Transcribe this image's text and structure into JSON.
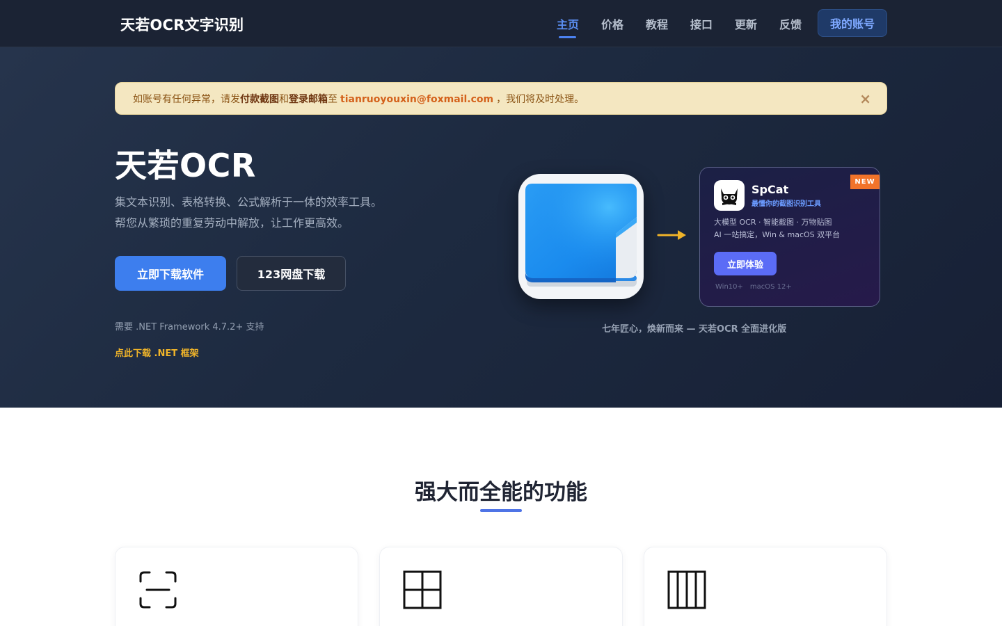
{
  "nav": {
    "brand": "天若OCR文字识别",
    "links": [
      {
        "label": "主页",
        "active": true
      },
      {
        "label": "价格",
        "active": false
      },
      {
        "label": "教程",
        "active": false
      },
      {
        "label": "接口",
        "active": false
      },
      {
        "label": "更新",
        "active": false
      },
      {
        "label": "反馈",
        "active": false
      }
    ],
    "account_label": "我的账号"
  },
  "notice": {
    "text_1": "如账号有任何异常，请发",
    "bold_1": "付款截图",
    "text_2": "和",
    "bold_2": "登录邮箱",
    "text_3": "至",
    "email": "tianruoyouxin@foxmail.com",
    "text_4": "，我们将及时处理。",
    "close_glyph": "×"
  },
  "hero": {
    "title": "天若OCR",
    "desc_line1": "集文本识别、表格转换、公式解析于一体的效率工具。",
    "desc_line2": "帮您从繁琐的重复劳动中解放，让工作更高效。",
    "download_label": "立即下载软件",
    "pan_label": "123网盘下载",
    "net_note": "需要 .NET Framework 4.7.2+ 支持",
    "net_link": "点此下载 .NET 框架"
  },
  "spcat": {
    "badge": "NEW",
    "name": "SpCat",
    "tagline": "最懂你的截图识别工具",
    "desc_line1": "大模型 OCR · 智能截图 · 万物贴图",
    "desc_line2": "AI 一站搞定，Win & macOS 双平台",
    "cta": "立即体验",
    "sys_win": "Win10+",
    "sys_mac": "macOS 12+"
  },
  "caption": "七年匠心，焕新而来 — 天若OCR 全面进化版",
  "features": {
    "title": "强大而全能的功能",
    "cards": [
      {
        "icon": "scan-icon"
      },
      {
        "icon": "table-grid-icon"
      },
      {
        "icon": "columns-icon"
      }
    ]
  },
  "colors": {
    "nav_bg": "#1b2334",
    "accent": "#3d7eee",
    "notice_bg": "#f4e7c1",
    "link_yellow": "#f0b429",
    "spcat_button": "#5b6cf6"
  }
}
